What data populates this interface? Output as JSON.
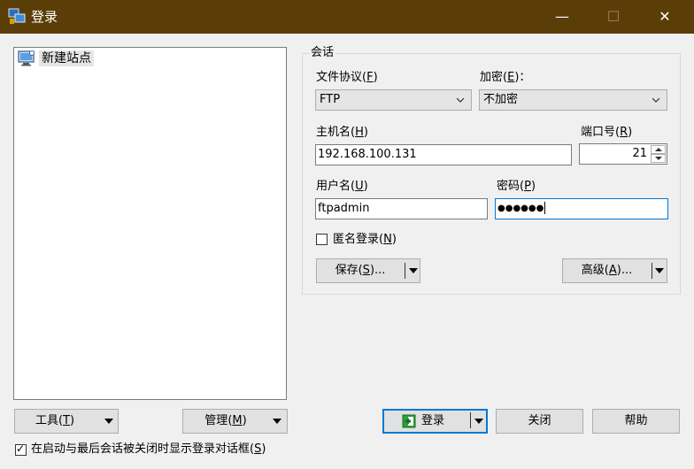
{
  "window": {
    "title": "登录",
    "minimize_glyph": "—",
    "maximize_glyph": "☐",
    "close_glyph": "✕"
  },
  "site_tree": {
    "items": [
      {
        "label": "新建站点",
        "icon": "computer-icon"
      }
    ]
  },
  "session": {
    "group_title": "会话",
    "protocol": {
      "label": "文件协议",
      "accel": "F",
      "value": "FTP"
    },
    "encryption": {
      "label": "加密",
      "accel": "E",
      "suffix": "：",
      "value": "不加密"
    },
    "host": {
      "label": "主机名",
      "accel": "H",
      "value": "192.168.100.131"
    },
    "port": {
      "label": "端口号",
      "accel": "R",
      "value": "21"
    },
    "username": {
      "label": "用户名",
      "accel": "U",
      "value": "ftpadmin"
    },
    "password": {
      "label": "密码",
      "accel": "P",
      "value": "●●●●●●"
    },
    "anonymous": {
      "label": "匿名登录",
      "accel": "N",
      "checked": false
    },
    "save_button": {
      "label": "保存",
      "accel": "S",
      "suffix": "..."
    },
    "advanced_button": {
      "label": "高级",
      "accel": "A",
      "suffix": "..."
    }
  },
  "bottom": {
    "tools_button": {
      "label": "工具",
      "accel": "T"
    },
    "manage_button": {
      "label": "管理",
      "accel": "M"
    },
    "login_button": {
      "label": "登录"
    },
    "close_button": {
      "label": "关闭"
    },
    "help_button": {
      "label": "帮助"
    },
    "show_on_startup": {
      "label": "在启动与最后会话被关闭时显示登录对话框",
      "accel": "S",
      "checked": true
    }
  },
  "colors": {
    "titlebar": "#5b3d08",
    "accent": "#0078d7"
  }
}
